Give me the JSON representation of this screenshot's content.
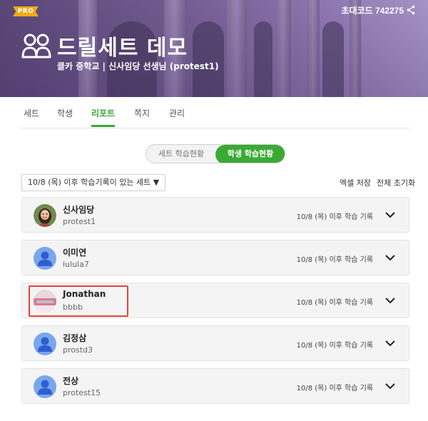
{
  "banner": {
    "pro_label": "PRO",
    "invite_code_label": "초대코드 742275",
    "class_title": "드릴세트 데모",
    "class_subtitle": "클카 중학교 | 신사임당 선생님 (protest1)"
  },
  "tabs": [
    {
      "label": "세트",
      "active": false
    },
    {
      "label": "학생",
      "active": false
    },
    {
      "label": "리포트",
      "active": true
    },
    {
      "label": "쪽지",
      "active": false
    },
    {
      "label": "관리",
      "active": false
    }
  ],
  "toggle": {
    "left_label": "세트 학습현황",
    "right_label": "학생 학습현황",
    "selected": "right"
  },
  "filter": {
    "selected_label": "10/8 (목) 이후 학습기록이 있는 세트 ▼"
  },
  "actions": {
    "export_label": "엑셀 저장",
    "reset_label": "전체 초기화"
  },
  "students": [
    {
      "name": "신사임당",
      "id": "protest1",
      "record": "10/8 (목) 이후 학습 기록",
      "avatar": "portrait"
    },
    {
      "name": "이미연",
      "id": "lulula7",
      "record": "10/8 (목) 이후 학습 기록",
      "avatar": "default"
    },
    {
      "name": "Jonathan",
      "id": "bbbb",
      "record": "10/8 (목) 이후 학습 기록",
      "avatar": "photo",
      "highlighted": true
    },
    {
      "name": "김정삼",
      "id": "prostd3",
      "record": "10/8 (목) 이후 학습 기록",
      "avatar": "default"
    },
    {
      "name": "전상",
      "id": "protest15",
      "record": "10/8 (목) 이후 학습 기록",
      "avatar": "default"
    }
  ],
  "colors": {
    "accent": "#3aaa35",
    "pro_badge": "#f2a818",
    "highlight": "#e2443b",
    "default_avatar": "#7aa6ee"
  }
}
